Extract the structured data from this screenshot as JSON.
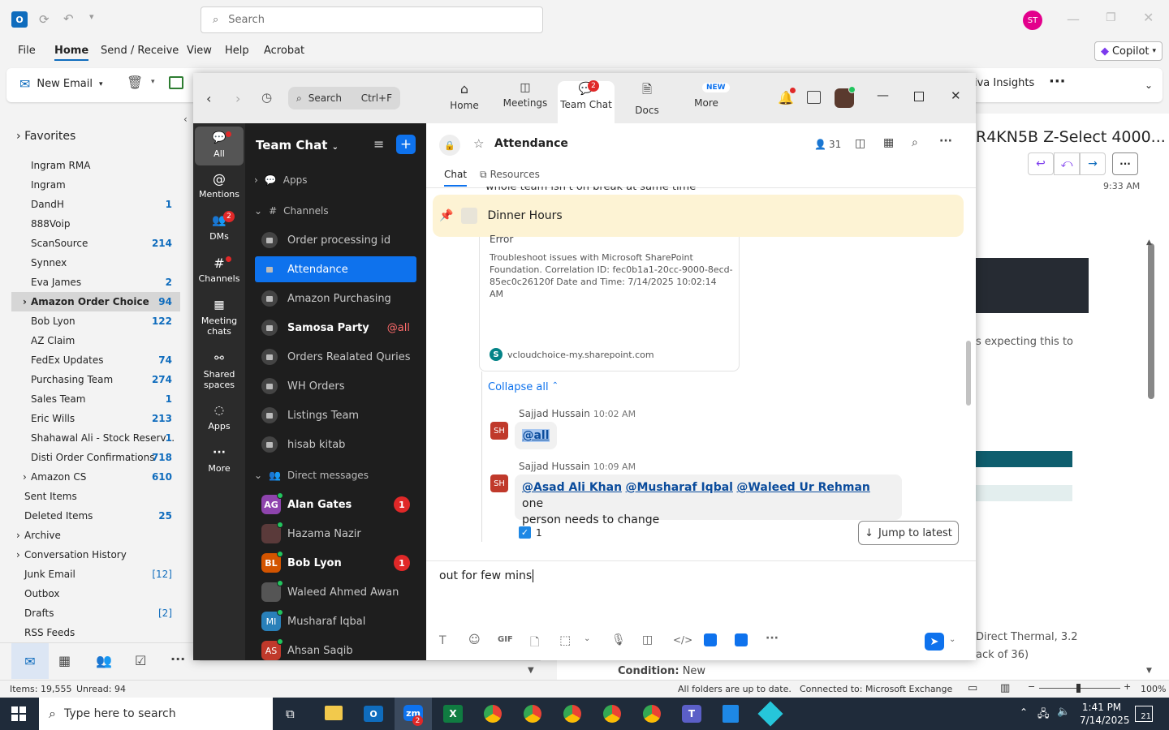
{
  "outlook": {
    "search_placeholder": "Search",
    "avatar": "ST",
    "menu": [
      "File",
      "Home",
      "Send / Receive",
      "View",
      "Help",
      "Acrobat"
    ],
    "copilot": "Copilot",
    "new_email": "New Email",
    "viva": "iva Insights",
    "favorites": "Favorites",
    "folders": [
      {
        "name": "Ingram RMA",
        "count": ""
      },
      {
        "name": "Ingram",
        "count": ""
      },
      {
        "name": "DandH",
        "count": "1"
      },
      {
        "name": "888Voip",
        "count": ""
      },
      {
        "name": "ScanSource",
        "count": "214"
      },
      {
        "name": "Synnex",
        "count": ""
      },
      {
        "name": "Eva James",
        "count": "2"
      },
      {
        "name": "Amazon Order Choice",
        "count": "94"
      },
      {
        "name": "Bob Lyon",
        "count": "122"
      },
      {
        "name": "AZ Claim",
        "count": ""
      },
      {
        "name": "FedEx Updates",
        "count": "74"
      },
      {
        "name": "Purchasing Team",
        "count": "274"
      },
      {
        "name": "Sales Team",
        "count": "1"
      },
      {
        "name": "Eric Wills",
        "count": "213"
      },
      {
        "name": "Shahawal Ali - Stock Reserv...",
        "count": "1"
      },
      {
        "name": "Disti Order Confirmations",
        "count": "718"
      },
      {
        "name": "Amazon CS",
        "count": "610"
      },
      {
        "name": "Sent Items",
        "count": ""
      },
      {
        "name": "Deleted Items",
        "count": "25"
      },
      {
        "name": "Archive",
        "count": ""
      },
      {
        "name": "Conversation History",
        "count": ""
      },
      {
        "name": "Junk Email",
        "count": "[12]"
      },
      {
        "name": "Outbox",
        "count": ""
      },
      {
        "name": "Drafts",
        "count": "[2]"
      },
      {
        "name": "RSS Feeds",
        "count": ""
      }
    ],
    "reading_subject": "R4KN5B Z-Select 4000...",
    "reading_time": "9:33 AM",
    "reading_snip1": "s expecting this to",
    "reading_snip2": "Direct Thermal, 3.2",
    "reading_snip3": "ack of 36)",
    "condition_label": "Condition:",
    "condition_value": "New",
    "status_items": "Items: 19,555",
    "status_unread": "Unread: 94",
    "status_sync": "All folders are up to date.",
    "status_conn": "Connected to: Microsoft Exchange",
    "zoom_level": "100%"
  },
  "taskbar": {
    "search_placeholder": "Type here to search",
    "time": "1:41 PM",
    "date": "7/14/2025",
    "notif": "21",
    "zoom_badge": "2"
  },
  "zoom": {
    "search": "Search",
    "search_shortcut": "Ctrl+F",
    "tabs": [
      {
        "label": "Home"
      },
      {
        "label": "Meetings"
      },
      {
        "label": "Team Chat",
        "badge": "2"
      },
      {
        "label": "Docs"
      },
      {
        "label": "More",
        "badge": "NEW"
      }
    ],
    "rail": [
      {
        "label": "All"
      },
      {
        "label": "Mentions"
      },
      {
        "label": "DMs",
        "badge": "2"
      },
      {
        "label": "Channels"
      },
      {
        "label": "Meeting chats"
      },
      {
        "label": "Shared spaces"
      },
      {
        "label": "Apps"
      },
      {
        "label": "More"
      }
    ],
    "sidebar_title": "Team Chat",
    "apps": "Apps",
    "channels_head": "Channels",
    "channels": [
      {
        "name": "Order processing id"
      },
      {
        "name": "Attendance"
      },
      {
        "name": "Amazon Purchasing"
      },
      {
        "name": "Samosa Party",
        "tag": "@all"
      },
      {
        "name": "Orders Realated Quries"
      },
      {
        "name": "WH Orders"
      },
      {
        "name": "Listings Team"
      },
      {
        "name": "hisab kitab"
      }
    ],
    "dm_head": "Direct messages",
    "dms": [
      {
        "name": "Alan Gates",
        "initials": "AG",
        "color": "#8e44ad",
        "badge": "1"
      },
      {
        "name": "Hazama Nazir",
        "initials": "",
        "color": "#5a3a3a",
        "badge": ""
      },
      {
        "name": "Bob Lyon",
        "initials": "BL",
        "color": "#d35400",
        "badge": "1"
      },
      {
        "name": "Waleed Ahmed Awan",
        "initials": "",
        "color": "#555555",
        "badge": ""
      },
      {
        "name": "Musharaf Iqbal",
        "initials": "MI",
        "color": "#2980b9",
        "badge": ""
      },
      {
        "name": "Ahsan Saqib",
        "initials": "AS",
        "color": "#c0392b",
        "badge": ""
      }
    ],
    "channel_title": "Attendance",
    "members": "31",
    "subtab_chat": "Chat",
    "subtab_resources": "Resources",
    "cut_text": "whole team isn't on break at same time",
    "pinned": "Dinner Hours",
    "error_title": "Error",
    "error_text": "Troubleshoot issues with Microsoft SharePoint Foundation. Correlation ID: fec0b1a1-20cc-9000-8ecd-85ec0c26120f Date and Time: 7/14/2025 10:02:14 AM",
    "link_domain": "vcloudchoice-my.sharepoint.com",
    "collapse": "Collapse all",
    "msg1": {
      "author": "Sajjad Hussain",
      "time": "10:02 AM",
      "initials": "SH",
      "text": "@all"
    },
    "msg2": {
      "author": "Sajjad Hussain",
      "time": "10:09 AM",
      "initials": "SH",
      "mention1": "@Asad Ali Khan",
      "mention2": "@Musharaf Iqbal",
      "mention3": "@Waleed Ur Rehman",
      "text1": "one",
      "text2": "person needs to change"
    },
    "reaction_count": "1",
    "jump_latest": "Jump to latest",
    "composer": "out for few mins",
    "gif": "GIF"
  }
}
